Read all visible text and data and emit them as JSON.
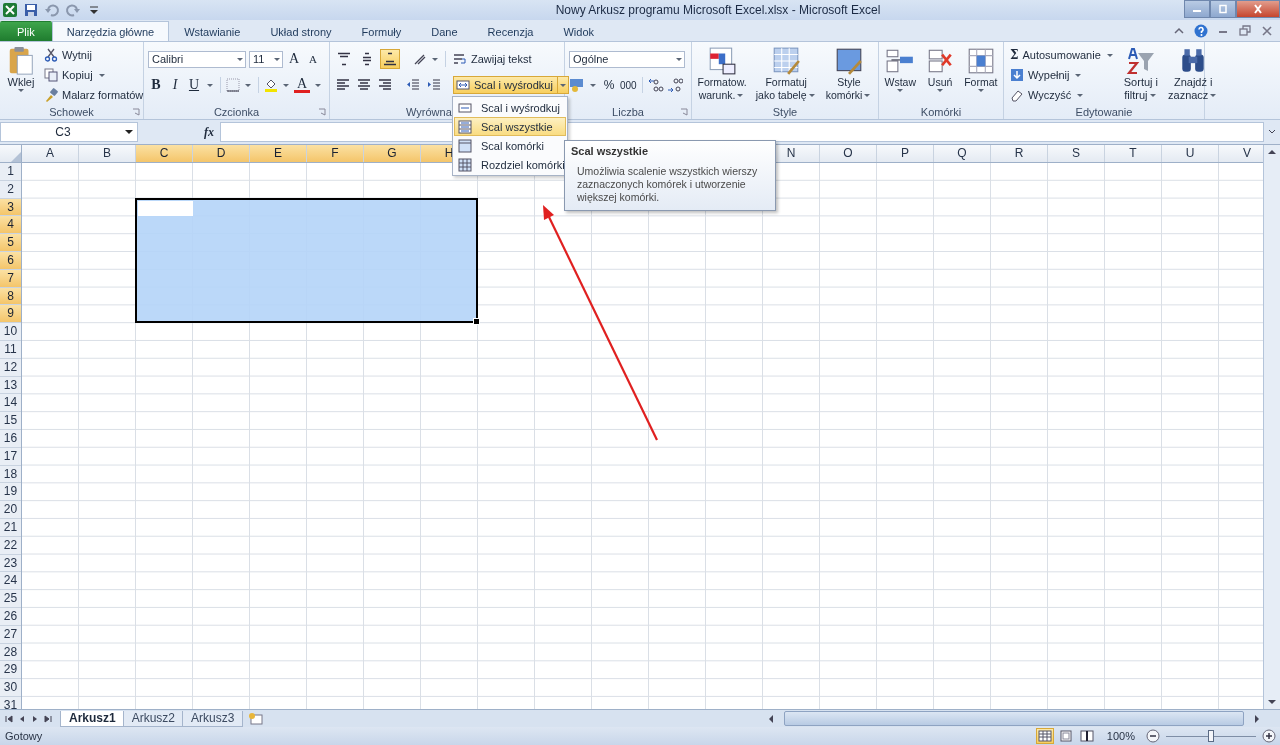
{
  "window": {
    "title": "Nowy Arkusz programu Microsoft Excel.xlsx  -  Microsoft Excel"
  },
  "tabs": [
    {
      "label": "Plik",
      "kind": "file",
      "selected": false
    },
    {
      "label": "Narzędzia główne",
      "kind": "tab",
      "selected": true
    },
    {
      "label": "Wstawianie",
      "kind": "tab",
      "selected": false
    },
    {
      "label": "Układ strony",
      "kind": "tab",
      "selected": false
    },
    {
      "label": "Formuły",
      "kind": "tab",
      "selected": false
    },
    {
      "label": "Dane",
      "kind": "tab",
      "selected": false
    },
    {
      "label": "Recenzja",
      "kind": "tab",
      "selected": false
    },
    {
      "label": "Widok",
      "kind": "tab",
      "selected": false
    }
  ],
  "clipboard": {
    "paste": "Wklej",
    "commands": [
      "Wytnij",
      "Kopiuj",
      "Malarz formatów"
    ],
    "group": "Schowek"
  },
  "font": {
    "family": "Calibri",
    "size": "11",
    "grow": "A",
    "shrink": "A",
    "bold": "B",
    "italic": "I",
    "underline": "U",
    "color_letter": "A",
    "group": "Czcionka"
  },
  "alignment": {
    "group": "Wyrówna",
    "wrap": "Zawijaj tekst",
    "merge": "Scal i wyśrodkuj",
    "vertical": [
      {
        "kind": "top",
        "selected": false
      },
      {
        "kind": "middle",
        "selected": false
      },
      {
        "kind": "bottom",
        "selected": true
      }
    ]
  },
  "number": {
    "format": "Ogólne",
    "percent": "%",
    "thousands": "000",
    "group": "Liczba"
  },
  "styles": {
    "commands": [
      {
        "line1": "Formatow.",
        "line2": "warunk.",
        "kind": "conditional"
      },
      {
        "line1": "Formatuj",
        "line2": "jako tabelę",
        "kind": "table"
      },
      {
        "line1": "Style",
        "line2": "komórki",
        "kind": "cellstyle"
      }
    ],
    "group": "Style"
  },
  "cells": {
    "commands": [
      {
        "label": "Wstaw",
        "kind": "insert"
      },
      {
        "label": "Usuń",
        "kind": "delete"
      },
      {
        "label": "Format",
        "kind": "format"
      }
    ],
    "group": "Komórki"
  },
  "editing": {
    "sigma": "Σ",
    "commands": [
      "Autosumowanie",
      "Wypełnij",
      "Wyczyść"
    ],
    "sort": {
      "line1": "Sortuj i",
      "line2": "filtruj"
    },
    "find": {
      "line1": "Znajdź i",
      "line2": "zaznacz"
    },
    "group": "Edytowanie"
  },
  "merge_menu": {
    "open": true,
    "items": [
      {
        "label": "Scal i wyśrodkuj",
        "kind": "center",
        "selected": false
      },
      {
        "label": "Scal wszystkie",
        "kind": "across",
        "selected": true
      },
      {
        "label": "Scal komórki",
        "kind": "merge",
        "selected": false
      },
      {
        "label": "Rozdziel komórki",
        "kind": "split",
        "selected": false
      }
    ]
  },
  "tooltip": {
    "title": "Scal wszystkie",
    "text": "Umożliwia scalenie wszystkich wierszy zaznaczonych komórek i utworzenie większej komórki."
  },
  "formula_bar": {
    "name_box": "C3",
    "function_label": "fx"
  },
  "sheet": {
    "columns": [
      {
        "label": "A",
        "selected": false
      },
      {
        "label": "B",
        "selected": false
      },
      {
        "label": "C",
        "selected": true
      },
      {
        "label": "D",
        "selected": true
      },
      {
        "label": "E",
        "selected": true
      },
      {
        "label": "F",
        "selected": true
      },
      {
        "label": "G",
        "selected": true
      },
      {
        "label": "H",
        "selected": true
      }
    ],
    "columns_right": [
      {
        "label": "N",
        "selected": false
      },
      {
        "label": "O",
        "selected": false
      },
      {
        "label": "P",
        "selected": false
      },
      {
        "label": "Q",
        "selected": false
      },
      {
        "label": "R",
        "selected": false
      },
      {
        "label": "S",
        "selected": false
      },
      {
        "label": "T",
        "selected": false
      },
      {
        "label": "U",
        "selected": false
      },
      {
        "label": "V",
        "selected": false
      }
    ],
    "rows": [
      {
        "label": "1",
        "selected": false
      },
      {
        "label": "2",
        "selected": false
      },
      {
        "label": "3",
        "selected": true
      },
      {
        "label": "4",
        "selected": true
      },
      {
        "label": "5",
        "selected": true
      },
      {
        "label": "6",
        "selected": true
      },
      {
        "label": "7",
        "selected": true
      },
      {
        "label": "8",
        "selected": true
      },
      {
        "label": "9",
        "selected": true
      },
      {
        "label": "10",
        "selected": false
      },
      {
        "label": "11",
        "selected": false
      },
      {
        "label": "12",
        "selected": false
      },
      {
        "label": "13",
        "selected": false
      },
      {
        "label": "14",
        "selected": false
      },
      {
        "label": "15",
        "selected": false
      },
      {
        "label": "16",
        "selected": false
      },
      {
        "label": "17",
        "selected": false
      },
      {
        "label": "18",
        "selected": false
      },
      {
        "label": "19",
        "selected": false
      },
      {
        "label": "20",
        "selected": false
      },
      {
        "label": "21",
        "selected": false
      },
      {
        "label": "22",
        "selected": false
      },
      {
        "label": "23",
        "selected": false
      },
      {
        "label": "24",
        "selected": false
      },
      {
        "label": "25",
        "selected": false
      },
      {
        "label": "26",
        "selected": false
      },
      {
        "label": "27",
        "selected": false
      },
      {
        "label": "28",
        "selected": false
      },
      {
        "label": "29",
        "selected": false
      },
      {
        "label": "30",
        "selected": false
      },
      {
        "label": "31",
        "selected": false
      }
    ]
  },
  "sheet_tabs": [
    {
      "label": "Arkusz1",
      "selected": true
    },
    {
      "label": "Arkusz2",
      "selected": false
    },
    {
      "label": "Arkusz3",
      "selected": false
    }
  ],
  "status_bar": {
    "text": "Gotowy",
    "views": [
      {
        "kind": "normal",
        "selected": true
      },
      {
        "kind": "layout",
        "selected": false
      },
      {
        "kind": "pagebreak",
        "selected": false
      }
    ],
    "zoom": "100%",
    "zoom_slider": {
      "level": 0.5
    }
  }
}
